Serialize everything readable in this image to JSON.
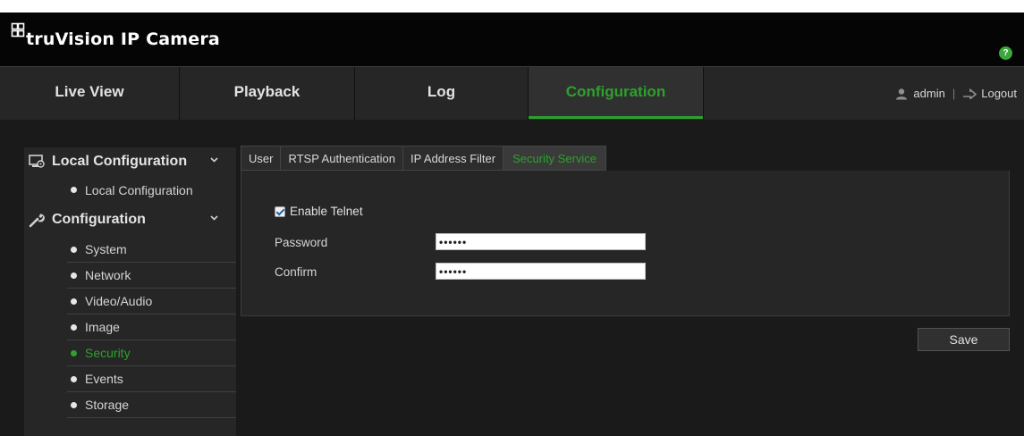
{
  "app": {
    "title": "truVision IP Camera",
    "help_icon": "?"
  },
  "nav": {
    "tabs": [
      {
        "label": "Live View"
      },
      {
        "label": "Playback"
      },
      {
        "label": "Log"
      },
      {
        "label": "Configuration",
        "active": true
      }
    ],
    "user": "admin",
    "separator": "|",
    "logout": "Logout"
  },
  "sidebar": {
    "sections": [
      {
        "title": "Local Configuration",
        "icon": "local-config-icon",
        "items": [
          "Local Configuration"
        ]
      },
      {
        "title": "Configuration",
        "icon": "wrench-icon",
        "items": [
          "System",
          "Network",
          "Video/Audio",
          "Image",
          "Security",
          "Events",
          "Storage"
        ],
        "active_item": "Security"
      }
    ]
  },
  "security": {
    "tabs": [
      "User",
      "RTSP Authentication",
      "IP Address Filter",
      "Security Service"
    ],
    "active_tab": "Security Service",
    "enable_telnet": {
      "label": "Enable Telnet",
      "checked": true
    },
    "password": {
      "label": "Password",
      "value": "••••••"
    },
    "confirm": {
      "label": "Confirm",
      "value": "••••••"
    },
    "save_label": "Save"
  },
  "colors": {
    "accent": "#2ea02e",
    "header_bg": "#050505",
    "nav_bg": "#262626",
    "content_bg": "#1a1a1a"
  }
}
